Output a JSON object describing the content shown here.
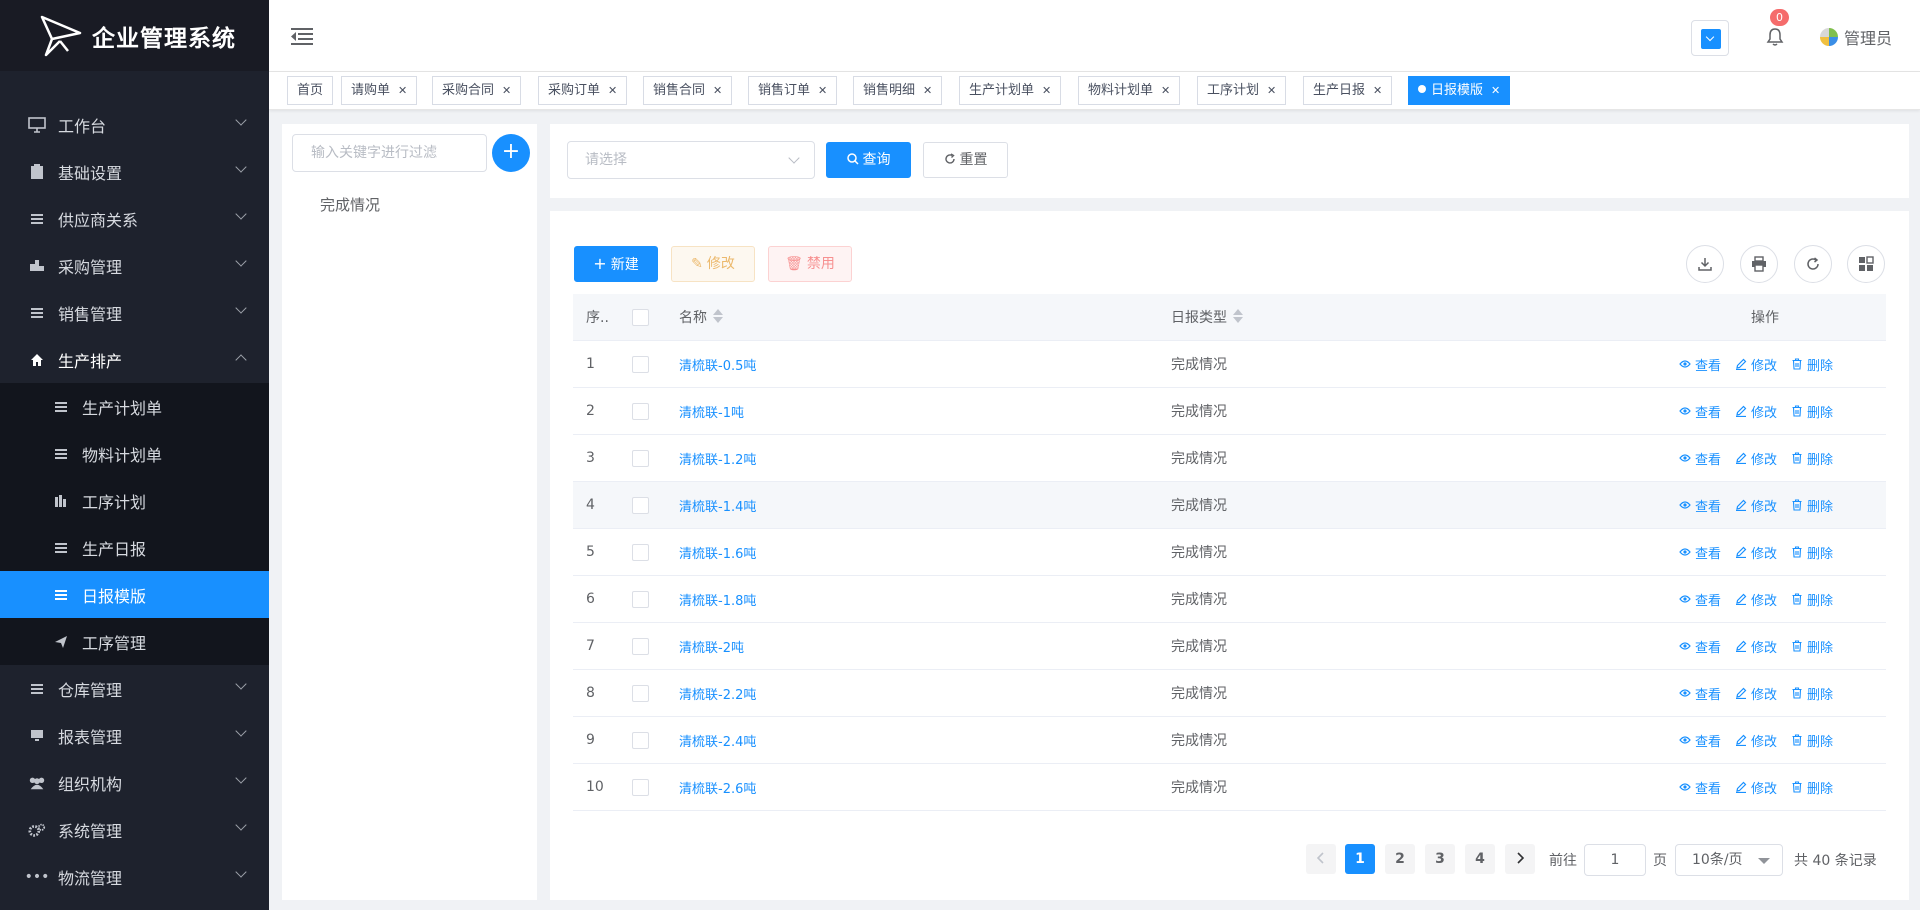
{
  "app": {
    "title": "企业管理系统"
  },
  "sidebar": {
    "items": [
      {
        "label": "工作台",
        "icon": "monitor-icon"
      },
      {
        "label": "基础设置",
        "icon": "clipboard-icon"
      },
      {
        "label": "供应商关系",
        "icon": "list-icon"
      },
      {
        "label": "采购管理",
        "icon": "truck-icon"
      },
      {
        "label": "销售管理",
        "icon": "list-icon"
      },
      {
        "label": "生产排产",
        "icon": "home-icon"
      },
      {
        "label": "仓库管理",
        "icon": "list-icon"
      },
      {
        "label": "报表管理",
        "icon": "monitor-icon"
      },
      {
        "label": "组织机构",
        "icon": "users-icon"
      },
      {
        "label": "系统管理",
        "icon": "gears-icon"
      },
      {
        "label": "物流管理",
        "icon": "ellipsis-icon"
      }
    ],
    "sub_items": [
      {
        "label": "生产计划单",
        "icon": "list-icon"
      },
      {
        "label": "物料计划单",
        "icon": "list-icon"
      },
      {
        "label": "工序计划",
        "icon": "bar-chart-icon"
      },
      {
        "label": "生产日报",
        "icon": "list-icon"
      },
      {
        "label": "日报模版",
        "icon": "list-icon"
      },
      {
        "label": "工序管理",
        "icon": "send-icon"
      }
    ]
  },
  "header": {
    "badge_count": "0",
    "user_name": "管理员"
  },
  "tabs": [
    "首页",
    "请购单",
    "采购合同",
    "采购订单",
    "销售合同",
    "销售订单",
    "销售明细",
    "生产计划单",
    "物料计划单",
    "工序计划",
    "生产日报",
    "日报模版"
  ],
  "tree": {
    "filter_placeholder": "输入关键字进行过滤",
    "add_label": "+",
    "nodes": [
      "完成情况"
    ]
  },
  "search": {
    "select_placeholder": "请选择",
    "query_label": "查询",
    "reset_label": "重置"
  },
  "toolbar": {
    "new_label": "新建",
    "edit_label": "修改",
    "disable_label": "禁用"
  },
  "table": {
    "headers": {
      "index": "序..",
      "name": "名称",
      "type": "日报类型",
      "ops": "操作"
    },
    "op_labels": {
      "view": "查看",
      "edit": "修改",
      "delete": "删除"
    },
    "rows": [
      {
        "index": "1",
        "name": "清梳联-0.5吨",
        "type": "完成情况"
      },
      {
        "index": "2",
        "name": "清梳联-1吨",
        "type": "完成情况"
      },
      {
        "index": "3",
        "name": "清梳联-1.2吨",
        "type": "完成情况"
      },
      {
        "index": "4",
        "name": "清梳联-1.4吨",
        "type": "完成情况"
      },
      {
        "index": "5",
        "name": "清梳联-1.6吨",
        "type": "完成情况"
      },
      {
        "index": "6",
        "name": "清梳联-1.8吨",
        "type": "完成情况"
      },
      {
        "index": "7",
        "name": "清梳联-2吨",
        "type": "完成情况"
      },
      {
        "index": "8",
        "name": "清梳联-2.2吨",
        "type": "完成情况"
      },
      {
        "index": "9",
        "name": "清梳联-2.4吨",
        "type": "完成情况"
      },
      {
        "index": "10",
        "name": "清梳联-2.6吨",
        "type": "完成情况"
      }
    ]
  },
  "pagination": {
    "pages": [
      "1",
      "2",
      "3",
      "4"
    ],
    "current": "1",
    "goto_label": "前往",
    "goto_value": "1",
    "page_unit": "页",
    "page_size": "10条/页",
    "total": "共 40 条记录"
  },
  "colors": {
    "primary": "#1890ff",
    "sidebar_bg": "#1e222d",
    "badge": "#f56c6c"
  }
}
